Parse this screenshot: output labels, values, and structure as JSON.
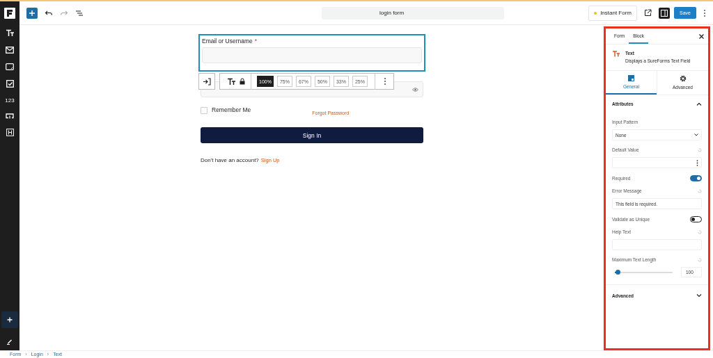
{
  "topbar": {
    "title": "login form",
    "status": {
      "label": "Instant Form",
      "color": "#e6c229"
    },
    "save": "Save"
  },
  "sidebar": {
    "items": [
      {
        "kind": "text"
      },
      {
        "kind": "email"
      },
      {
        "kind": "textarea"
      },
      {
        "kind": "checkbox"
      },
      {
        "kind": "number",
        "label": "123"
      },
      {
        "kind": "button"
      },
      {
        "kind": "heading"
      }
    ]
  },
  "form": {
    "email": {
      "label": "Email or Username",
      "required_mark": "*",
      "selected": true
    },
    "remember": {
      "label": "Remember Me",
      "checked": false
    },
    "forgot": "Forgot Password",
    "submit": "Sign In",
    "prompt": "Don't have an account?",
    "signup": "Sign Up"
  },
  "block_toolbar": {
    "widths": [
      {
        "label": "100%",
        "selected": true
      },
      {
        "label": "75%",
        "selected": false
      },
      {
        "label": "67%",
        "selected": false
      },
      {
        "label": "50%",
        "selected": false
      },
      {
        "label": "33%",
        "selected": false
      },
      {
        "label": "25%",
        "selected": false
      }
    ]
  },
  "panel": {
    "tabs": [
      {
        "label": "Form",
        "selected": false
      },
      {
        "label": "Block",
        "selected": true
      }
    ],
    "block": {
      "title": "Text",
      "description": "Displays a SureForms Text Field"
    },
    "subtabs": [
      {
        "label": "General",
        "kind": "general",
        "selected": true
      },
      {
        "label": "Advanced",
        "kind": "advanced",
        "selected": false
      }
    ],
    "attributes": {
      "title": "Attributes",
      "expanded": true
    },
    "settings": [
      {
        "kind": "select",
        "label": "Input Pattern",
        "value": "None"
      },
      {
        "kind": "text",
        "label": "Default Value",
        "menu": true
      },
      {
        "kind": "toggle",
        "label": "Required",
        "on": true
      },
      {
        "kind": "text",
        "label": "Error Message",
        "value": "This field is required."
      },
      {
        "kind": "toggle",
        "label": "Validate as Unique",
        "on": false
      },
      {
        "kind": "text",
        "label": "Help Text"
      },
      {
        "kind": "slider",
        "label": "Maximum Text Length",
        "level": 0.06,
        "value": "100"
      }
    ],
    "advanced": {
      "title": "Advanced",
      "expanded": false
    }
  },
  "breadcrumb": [
    {
      "kind": "link",
      "label": "Form"
    },
    {
      "kind": "separator",
      "label": "›"
    },
    {
      "kind": "link",
      "label": "Login"
    },
    {
      "kind": "separator",
      "label": "›"
    },
    {
      "kind": "link",
      "label": "Text"
    }
  ]
}
